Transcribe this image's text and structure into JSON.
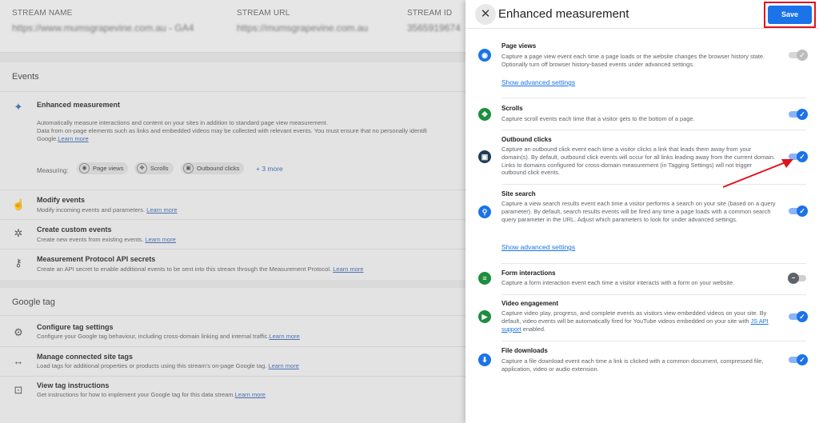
{
  "background": {
    "stream": {
      "name_label": "STREAM NAME",
      "name_value": "https://www.mumsgrapevine.com.au - GA4",
      "url_label": "STREAM URL",
      "url_value": "https://mumsgrapevine.com.au",
      "id_label": "STREAM ID",
      "id_value": "3565919674"
    },
    "events": {
      "title": "Events",
      "enhanced": {
        "title": "Enhanced measurement",
        "desc1": "Automatically measure interactions and content on your sites in addition to standard page view measurement.",
        "desc2": "Data from on-page elements such as links and embedded videos may be collected with relevant events. You must ensure that no personally identifi",
        "desc3": "Google.",
        "learn_more": "Learn more",
        "measuring_label": "Measuring:",
        "chips": [
          "Page views",
          "Scrolls",
          "Outbound clicks"
        ],
        "more": "+ 3 more"
      },
      "modify": {
        "title": "Modify events",
        "desc": "Modify incoming events and parameters.",
        "link": "Learn more"
      },
      "custom": {
        "title": "Create custom events",
        "desc": "Create new events from existing events.",
        "link": "Learn more"
      },
      "mp": {
        "title": "Measurement Protocol API secrets",
        "desc": "Create an API secret to enable additional events to be sent into this stream through the Measurement Protocol.",
        "link": "Learn more"
      }
    },
    "google_tag": {
      "title": "Google tag",
      "configure": {
        "title": "Configure tag settings",
        "desc": "Configure your Google tag behaviour, including cross-domain linking and internal traffic.",
        "link": "Learn more"
      },
      "connected": {
        "title": "Manage connected site tags",
        "desc": "Load tags for additional properties or products using this stream's on-page Google tag.",
        "link": "Learn more"
      },
      "view": {
        "title": "View tag instructions",
        "desc": "Get instructions for how to implement your Google tag for this data stream.",
        "link": "Learn more"
      }
    }
  },
  "panel": {
    "title": "Enhanced measurement",
    "save_label": "Save",
    "close_glyph": "✕",
    "sections": {
      "page_views": {
        "title": "Page views",
        "desc": "Capture a page view event each time a page loads or the website changes the browser history state. Optionally turn off browser history-based events under advanced settings.",
        "link": "Show advanced settings",
        "enabled": true,
        "locked": true,
        "icon_color": "#1a73e8"
      },
      "scrolls": {
        "title": "Scrolls",
        "desc": "Capture scroll events each time that a visitor gets to the bottom of a page.",
        "enabled": true,
        "icon_color": "#1e8e3e"
      },
      "outbound": {
        "title": "Outbound clicks",
        "desc": "Capture an outbound click event each time a visitor clicks a link that leads them away from your domain(s). By default, outbound click events will occur for all links leading away from the current domain. Links to domains configured for cross-domain measurement (in Tagging Settings) will not trigger outbound click events.",
        "enabled": true,
        "icon_color": "#1f3b57"
      },
      "site_search": {
        "title": "Site search",
        "desc": "Capture a view search results event each time a visitor performs a search on your site (based on a query parameter). By default, search results events will be fired any time a page loads with a common search query parameter in the URL. Adjust which parameters to look for under advanced settings.",
        "link": "Show advanced settings",
        "enabled": true,
        "icon_color": "#1a73e8"
      },
      "forms": {
        "title": "Form interactions",
        "desc": "Capture a form interaction event each time a visitor interacts with a form on your website.",
        "enabled": false,
        "icon_color": "#1e8e3e"
      },
      "video": {
        "title": "Video engagement",
        "desc_pre": "Capture video play, progress, and complete events as visitors view embedded videos on your site. By default, video events will be automatically fired for YouTube videos embedded on your site with ",
        "desc_link": "JS API support",
        "desc_post": " enabled.",
        "enabled": true,
        "icon_color": "#1e8e3e"
      },
      "downloads": {
        "title": "File downloads",
        "desc": "Capture a file download event each time a link is clicked with a common document, compressed file, application, video or audio extension.",
        "enabled": true,
        "icon_color": "#1a73e8"
      }
    }
  },
  "annotation": {
    "arrow_color": "#e0121b",
    "highlight_color": "#e0121b"
  }
}
